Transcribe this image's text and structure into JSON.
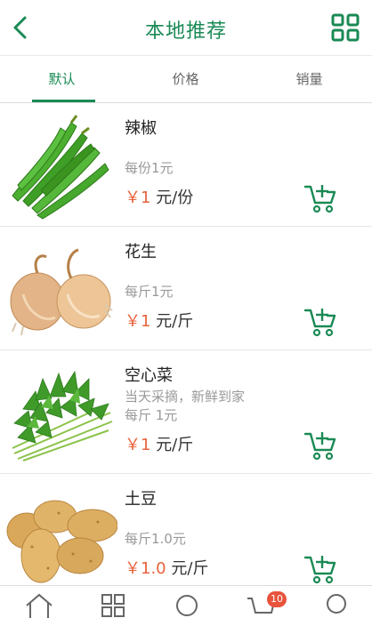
{
  "header": {
    "title": "本地推荐"
  },
  "tabs": [
    {
      "label": "默认",
      "active": true
    },
    {
      "label": "价格",
      "active": false
    },
    {
      "label": "销量",
      "active": false
    }
  ],
  "products": [
    {
      "name": "辣椒",
      "desc": "",
      "unit": "每份1元",
      "price_symbol": "￥",
      "price": "1",
      "per": " 元/份"
    },
    {
      "name": "花生",
      "desc": "",
      "unit": "每斤1元",
      "price_symbol": "￥",
      "price": "1",
      "per": " 元/斤"
    },
    {
      "name": "空心菜",
      "desc": "当天采摘，新鲜到家",
      "unit": "每斤 1元",
      "price_symbol": "￥",
      "price": "1",
      "per": " 元/斤"
    },
    {
      "name": "土豆",
      "desc": "",
      "unit": "每斤1.0元",
      "price_symbol": "￥",
      "price": "1.0",
      "per": " 元/斤"
    }
  ],
  "tabbar": {
    "cart_badge": "10"
  },
  "colors": {
    "brand": "#1a8a55",
    "price": "#e8633c",
    "badge": "#e8533c"
  }
}
